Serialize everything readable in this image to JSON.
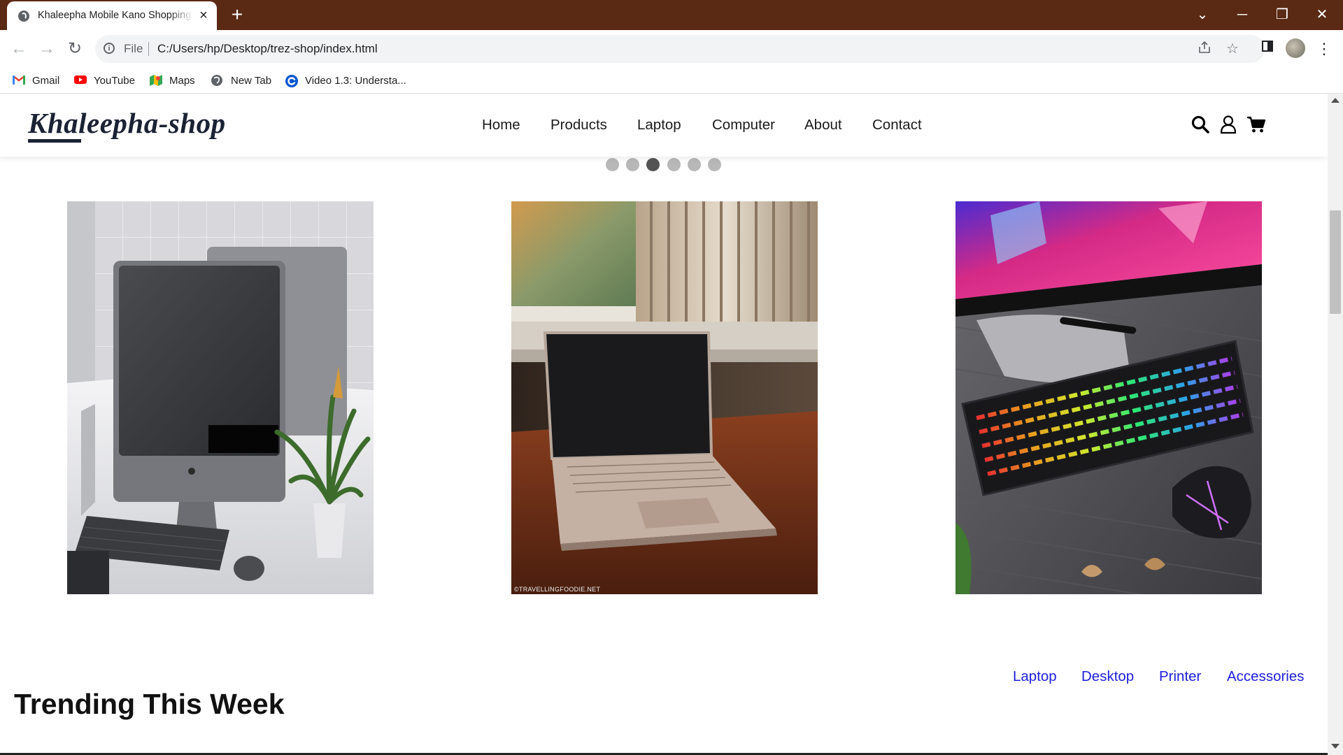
{
  "browser": {
    "tab": {
      "title": "Khaleepha Mobile Kano Shopping",
      "close": "×"
    },
    "new_tab": "+",
    "window_controls": {
      "dropdown": "⌄",
      "minimize": "─",
      "restore": "❐",
      "close": "✕"
    },
    "nav": {
      "back": "←",
      "forward": "→",
      "reload": "↻"
    },
    "address": {
      "scheme": "File",
      "url": "C:/Users/hp/Desktop/trez-shop/index.html"
    },
    "bookmarks": [
      {
        "label": "Gmail",
        "icon": "gmail-icon"
      },
      {
        "label": "YouTube",
        "icon": "youtube-icon"
      },
      {
        "label": "Maps",
        "icon": "maps-icon"
      },
      {
        "label": "New Tab",
        "icon": "globe-icon"
      },
      {
        "label": "Video 1.3: Understa...",
        "icon": "coursera-icon"
      }
    ]
  },
  "site": {
    "logo": "Khaleepha-shop",
    "nav": [
      "Home",
      "Products",
      "Laptop",
      "Computer",
      "About",
      "Contact"
    ],
    "header_icons": [
      "search-icon",
      "user-icon",
      "cart-icon"
    ]
  },
  "carousel": {
    "dot_count": 6,
    "active_index": 2,
    "cards": [
      {
        "name": "imac-desk-image"
      },
      {
        "name": "laptop-window-image",
        "watermark": "©TRAVELLINGFOODIE.NET"
      },
      {
        "name": "gaming-keyboard-image"
      }
    ]
  },
  "trending": {
    "title": "Trending This Week",
    "tabs": [
      "Laptop",
      "Desktop",
      "Printer",
      "Accessories"
    ]
  },
  "colors": {
    "tabstrip": "#5b2a14",
    "logo": "#1b2233",
    "link": "#1e1ed8",
    "active_dot": "#545454",
    "inactive_dot": "#b8b8b8"
  }
}
